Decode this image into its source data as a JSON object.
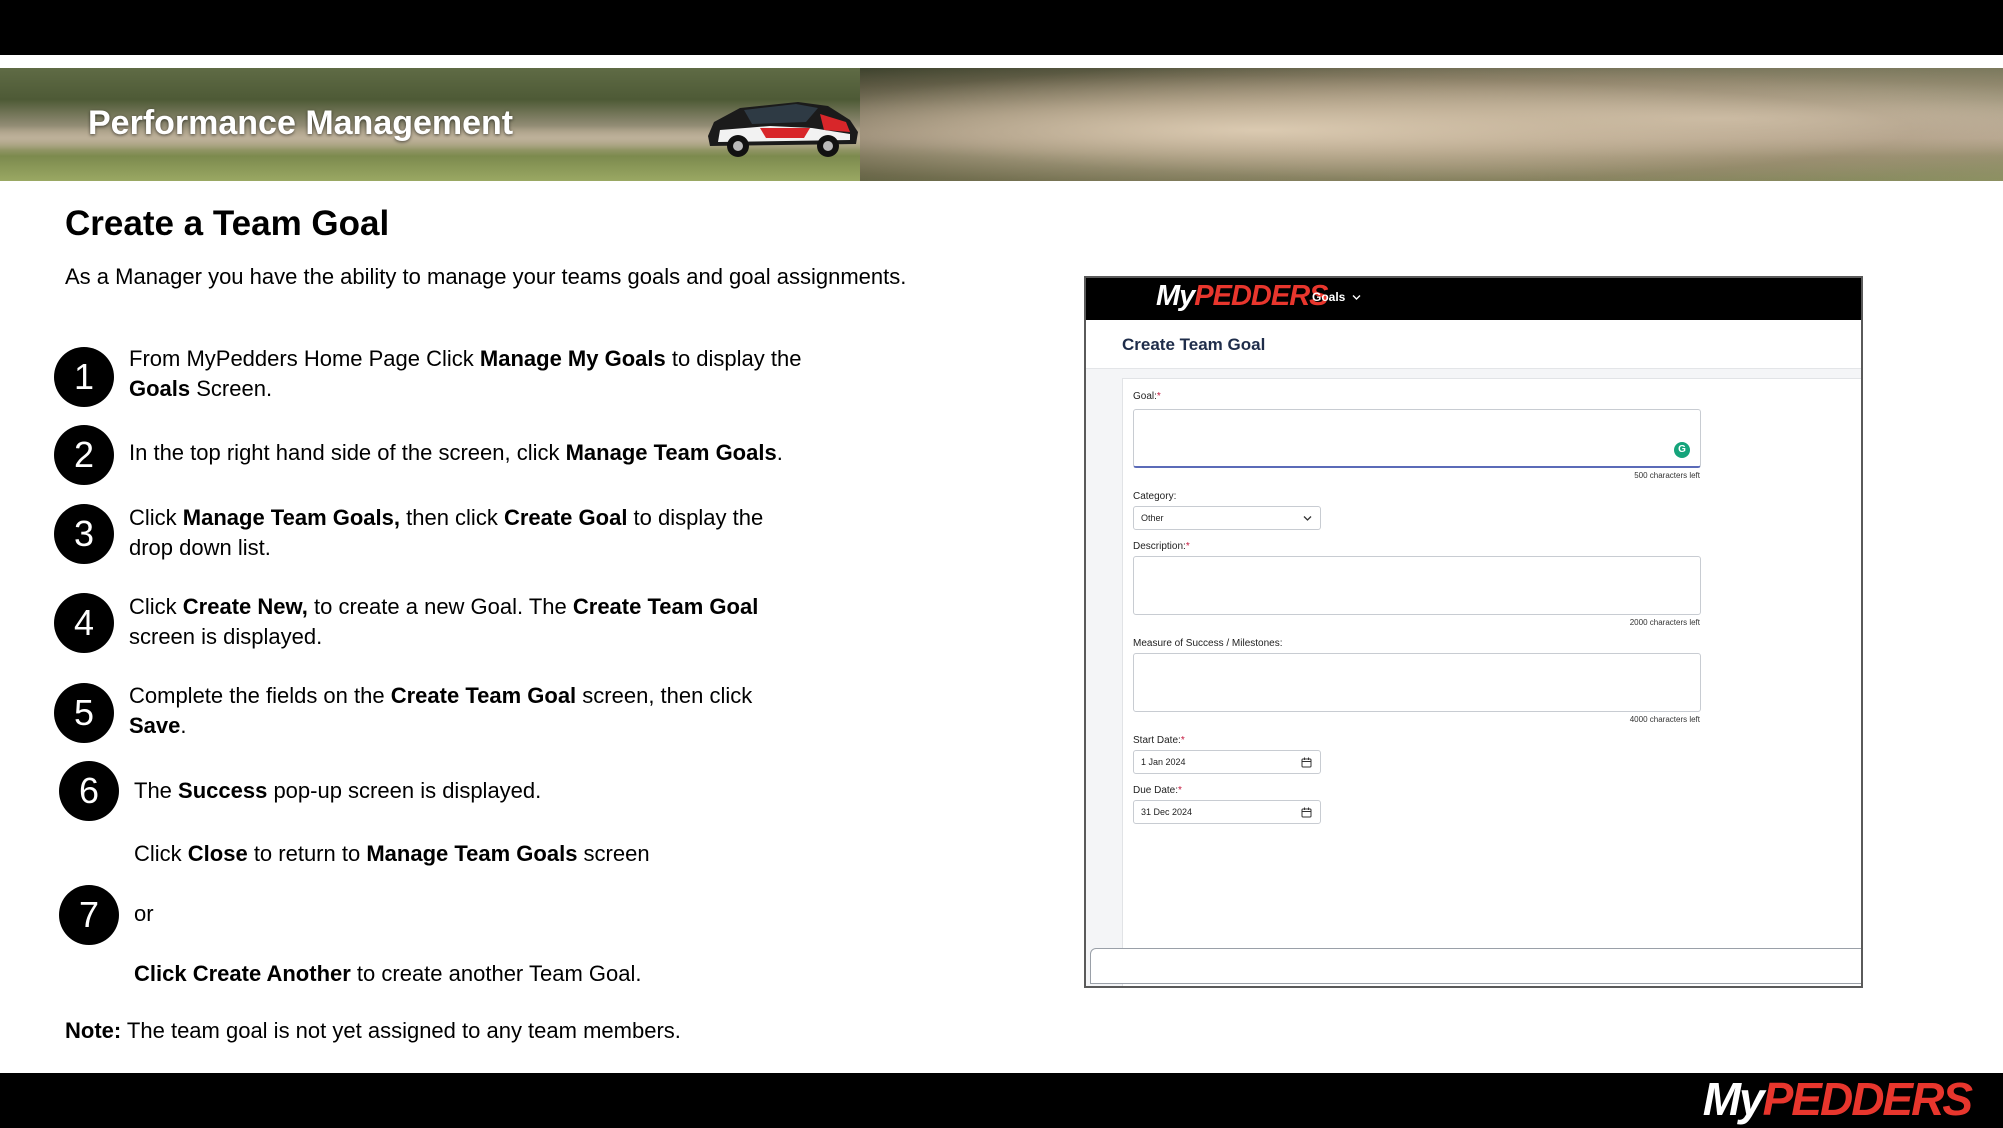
{
  "banner": {
    "title": "Performance Management"
  },
  "page": {
    "heading": "Create a Team Goal",
    "intro": "As a Manager you have the ability to manage your teams goals and goal assignments."
  },
  "steps": [
    {
      "num": "1",
      "line1": [
        "From MyPedders Home Page Click ",
        "Manage My Goals",
        " to display the"
      ],
      "line2": [
        "Goals",
        " Screen."
      ]
    },
    {
      "num": "2",
      "line1": [
        "In the top right hand side of the screen, click ",
        "Manage Team Goals",
        "."
      ]
    },
    {
      "num": "3",
      "line1": [
        "Click ",
        "Manage Team Goals,",
        " then click ",
        "Create Goal",
        " to display the"
      ],
      "line2": [
        "drop down list."
      ]
    },
    {
      "num": "4",
      "line1": [
        "Click ",
        "Create New,",
        " to create a new Goal. The ",
        "Create Team Goal"
      ],
      "line2": [
        "screen is displayed."
      ]
    },
    {
      "num": "5",
      "line1": [
        "Complete the fields on the ",
        "Create Team Goal",
        " screen, then click"
      ],
      "line2": [
        "Save",
        "."
      ]
    },
    {
      "num": "6",
      "line1": [
        "The ",
        "Success",
        " pop-up screen is displayed."
      ],
      "line2": [
        "Click ",
        "Close",
        " to return to ",
        "Manage Team Goals",
        " screen"
      ]
    },
    {
      "num": "7",
      "line1": [
        "or"
      ],
      "line2": [
        "Click Create Another",
        " to create another Team Goal."
      ]
    }
  ],
  "note": {
    "label": "Note:",
    "text": " The team goal is not yet assigned to any team members."
  },
  "logo": {
    "my": "My",
    "pedders": "PEDDERS"
  },
  "screenshot": {
    "nav_goals": "Goals",
    "title": "Create Team Goal",
    "goal_label": "Goal:",
    "goal_counter": "500 characters left",
    "category_label": "Category:",
    "category_value": "Other",
    "description_label": "Description:",
    "description_counter": "2000 characters left",
    "measure_label": "Measure of Success / Milestones:",
    "measure_counter": "4000 characters left",
    "start_label": "Start Date:",
    "start_value": "1 Jan 2024",
    "due_label": "Due Date:",
    "due_value": "31 Dec 2024",
    "required_mark": "*",
    "grammarly_glyph": "G"
  },
  "colors": {
    "brand_red": "#e8362d",
    "bar": "#000000",
    "required": "#c4153c"
  }
}
